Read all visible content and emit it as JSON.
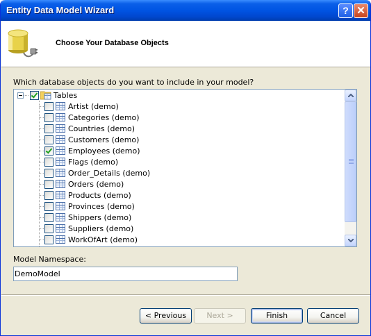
{
  "window": {
    "title": "Entity Data Model Wizard"
  },
  "header": {
    "title": "Choose Your Database Objects"
  },
  "prompt": "Which database objects do you want to include in your model?",
  "tree": {
    "root": {
      "label": "Tables",
      "checked": true
    },
    "items": [
      {
        "label": "Artist (demo)",
        "checked": false
      },
      {
        "label": "Categories (demo)",
        "checked": false
      },
      {
        "label": "Countries (demo)",
        "checked": false
      },
      {
        "label": "Customers (demo)",
        "checked": false
      },
      {
        "label": "Employees (demo)",
        "checked": true
      },
      {
        "label": "Flags (demo)",
        "checked": false
      },
      {
        "label": "Order_Details (demo)",
        "checked": false
      },
      {
        "label": "Orders (demo)",
        "checked": false
      },
      {
        "label": "Products (demo)",
        "checked": false
      },
      {
        "label": "Provinces (demo)",
        "checked": false
      },
      {
        "label": "Shippers (demo)",
        "checked": false
      },
      {
        "label": "Suppliers (demo)",
        "checked": false
      },
      {
        "label": "WorkOfArt (demo)",
        "checked": false
      }
    ]
  },
  "namespace": {
    "label": "Model Namespace:",
    "value": "DemoModel"
  },
  "buttons": {
    "previous": "< Previous",
    "next": "Next >",
    "finish": "Finish",
    "cancel": "Cancel"
  },
  "icons": {
    "help": "help-icon",
    "close": "close-icon",
    "header": "database-plug-icon",
    "table": "table-icon"
  }
}
